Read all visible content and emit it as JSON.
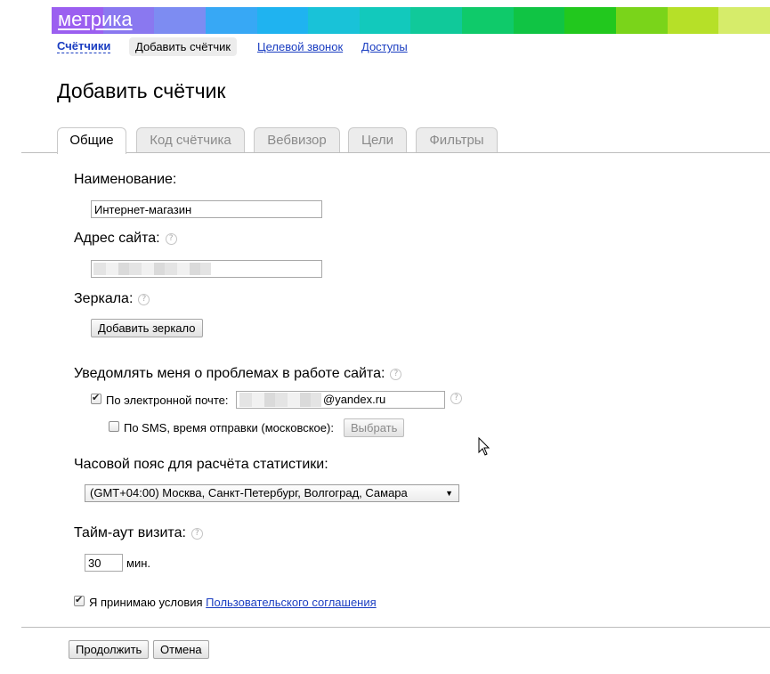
{
  "header": {
    "logo_text": "метрика",
    "rainbow_colors": [
      "#9b5ff0",
      "#8a78f0",
      "#7d8cf2",
      "#37a8f5",
      "#1fb3f0",
      "#19c2d8",
      "#12c9bc",
      "#10c99a",
      "#0fca6a",
      "#10c444",
      "#22c81e",
      "#7ad41a",
      "#b6e028",
      "#d6ec6a"
    ]
  },
  "nav": {
    "counters": "Счётчики",
    "add_counter": "Добавить счётчик",
    "target_call": "Целевой звонок",
    "access": "Доступы"
  },
  "page_title": "Добавить счётчик",
  "tabs": [
    {
      "label": "Общие",
      "active": true
    },
    {
      "label": "Код счётчика",
      "active": false
    },
    {
      "label": "Вебвизор",
      "active": false
    },
    {
      "label": "Цели",
      "active": false
    },
    {
      "label": "Фильтры",
      "active": false
    }
  ],
  "form": {
    "name_label": "Наименование:",
    "name_value": "Интернет-магазин",
    "site_label": "Адрес сайта:",
    "mirrors_label": "Зеркала:",
    "add_mirror_button": "Добавить зеркало",
    "notify_label": "Уведомлять меня о проблемах в работе сайта:",
    "email_checkbox_label": "По электронной почте:",
    "email_checked": true,
    "email_domain": "@yandex.ru",
    "sms_checkbox_label": "По SMS, время отправки (московское):",
    "sms_checked": false,
    "sms_choose_button": "Выбрать",
    "timezone_label": "Часовой пояс для расчёта статистики:",
    "timezone_value": "(GMT+04:00) Москва, Санкт-Петербург, Волгоград, Самара",
    "timeout_label": "Тайм-аут визита:",
    "timeout_value": "30",
    "timeout_unit": "мин.",
    "agree_prefix": "Я принимаю условия",
    "agree_link": "Пользовательского соглашения",
    "agree_checked": true
  },
  "actions": {
    "continue": "Продолжить",
    "cancel": "Отмена"
  },
  "help_glyph": "?"
}
